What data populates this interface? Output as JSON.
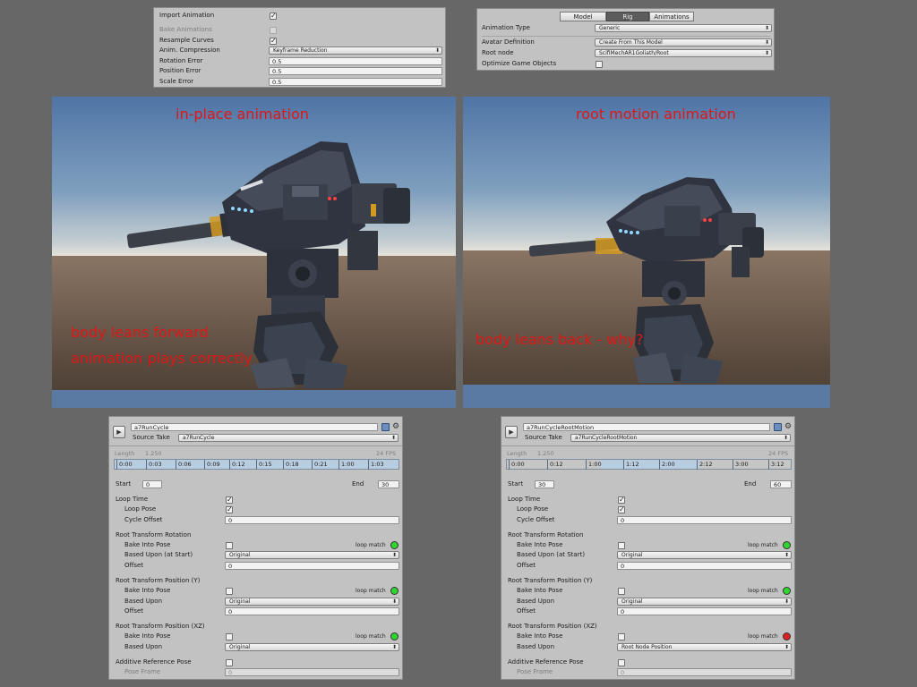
{
  "import_panel": {
    "import_animation": "Import Animation",
    "bake_animations": "Bake Animations",
    "resample_curves": "Resample Curves",
    "anim_compression_label": "Anim. Compression",
    "anim_compression_value": "Keyframe Reduction",
    "rotation_error_label": "Rotation Error",
    "rotation_error_value": "0.5",
    "position_error_label": "Position Error",
    "position_error_value": "0.5",
    "scale_error_label": "Scale Error",
    "scale_error_value": "0.5"
  },
  "rig_panel": {
    "tabs": [
      "Model",
      "Rig",
      "Animations"
    ],
    "active_tab": "Rig",
    "animation_type_label": "Animation Type",
    "animation_type_value": "Generic",
    "avatar_definition_label": "Avatar Definition",
    "avatar_definition_value": "Create From This Model",
    "root_node_label": "Root node",
    "root_node_value": "ScifiMechAR1Goliath/Root",
    "optimize_label": "Optimize Game Objects"
  },
  "viewport_left": {
    "title": "in-place animation",
    "note_line1": "body leans forward",
    "note_line2": "animation plays correctly"
  },
  "viewport_right": {
    "title": "root motion animation",
    "note": "body leans back - why?"
  },
  "clip_left": {
    "name": "a7RunCycle",
    "source_take_label": "Source Take",
    "source_take_value": "a7RunCycle",
    "length_label": "Length",
    "length_value": "1.250",
    "fps": "24 FPS",
    "ticks": [
      "0:00",
      "0:03",
      "0:06",
      "0:09",
      "0:12",
      "0:15",
      "0:18",
      "0:21",
      "1:00",
      "1:03"
    ],
    "start_label": "Start",
    "start_value": "0",
    "end_label": "End",
    "end_value": "30",
    "loop_time": "Loop Time",
    "loop_pose": "Loop Pose",
    "cycle_offset_label": "Cycle Offset",
    "cycle_offset_value": "0",
    "rot_header": "Root Transform Rotation",
    "bake_into_pose": "Bake Into Pose",
    "loop_match": "loop match",
    "rot_based_upon_label": "Based Upon (at Start)",
    "rot_based_upon_value": "Original",
    "offset_label": "Offset",
    "rot_offset_value": "0",
    "posy_header": "Root Transform Position (Y)",
    "posy_based_upon_label": "Based Upon",
    "posy_based_upon_value": "Original",
    "posy_offset_value": "0",
    "posxz_header": "Root Transform Position (XZ)",
    "posxz_based_upon_label": "Based Upon",
    "posxz_based_upon_value": "Original",
    "additive_label": "Additive Reference Pose",
    "pose_frame_label": "Pose Frame",
    "pose_frame_value": "0",
    "match_colors": [
      "#2fd62f",
      "#2fd62f",
      "#2fd62f"
    ]
  },
  "clip_right": {
    "name": "a7RunCycleRootMotion",
    "source_take_label": "Source Take",
    "source_take_value": "a7RunCycleRootMotion",
    "length_label": "Length",
    "length_value": "1.250",
    "fps": "24 FPS",
    "ticks": [
      "0:00",
      "0:12",
      "1:00",
      "1:12",
      "2:00",
      "2:12",
      "3:00",
      "3:12"
    ],
    "start_label": "Start",
    "start_value": "30",
    "end_label": "End",
    "end_value": "60",
    "loop_time": "Loop Time",
    "loop_pose": "Loop Pose",
    "cycle_offset_label": "Cycle Offset",
    "cycle_offset_value": "0",
    "rot_header": "Root Transform Rotation",
    "bake_into_pose": "Bake Into Pose",
    "loop_match": "loop match",
    "rot_based_upon_label": "Based Upon (at Start)",
    "rot_based_upon_value": "Original",
    "offset_label": "Offset",
    "rot_offset_value": "0",
    "posy_header": "Root Transform Position (Y)",
    "posy_based_upon_label": "Based Upon",
    "posy_based_upon_value": "Original",
    "posy_offset_value": "0",
    "posxz_header": "Root Transform Position (XZ)",
    "posxz_based_upon_label": "Based Upon",
    "posxz_based_upon_value": "Root Node Position",
    "additive_label": "Additive Reference Pose",
    "pose_frame_label": "Pose Frame",
    "pose_frame_value": "0",
    "match_colors": [
      "#2fd62f",
      "#2fd62f",
      "#e02020"
    ]
  }
}
